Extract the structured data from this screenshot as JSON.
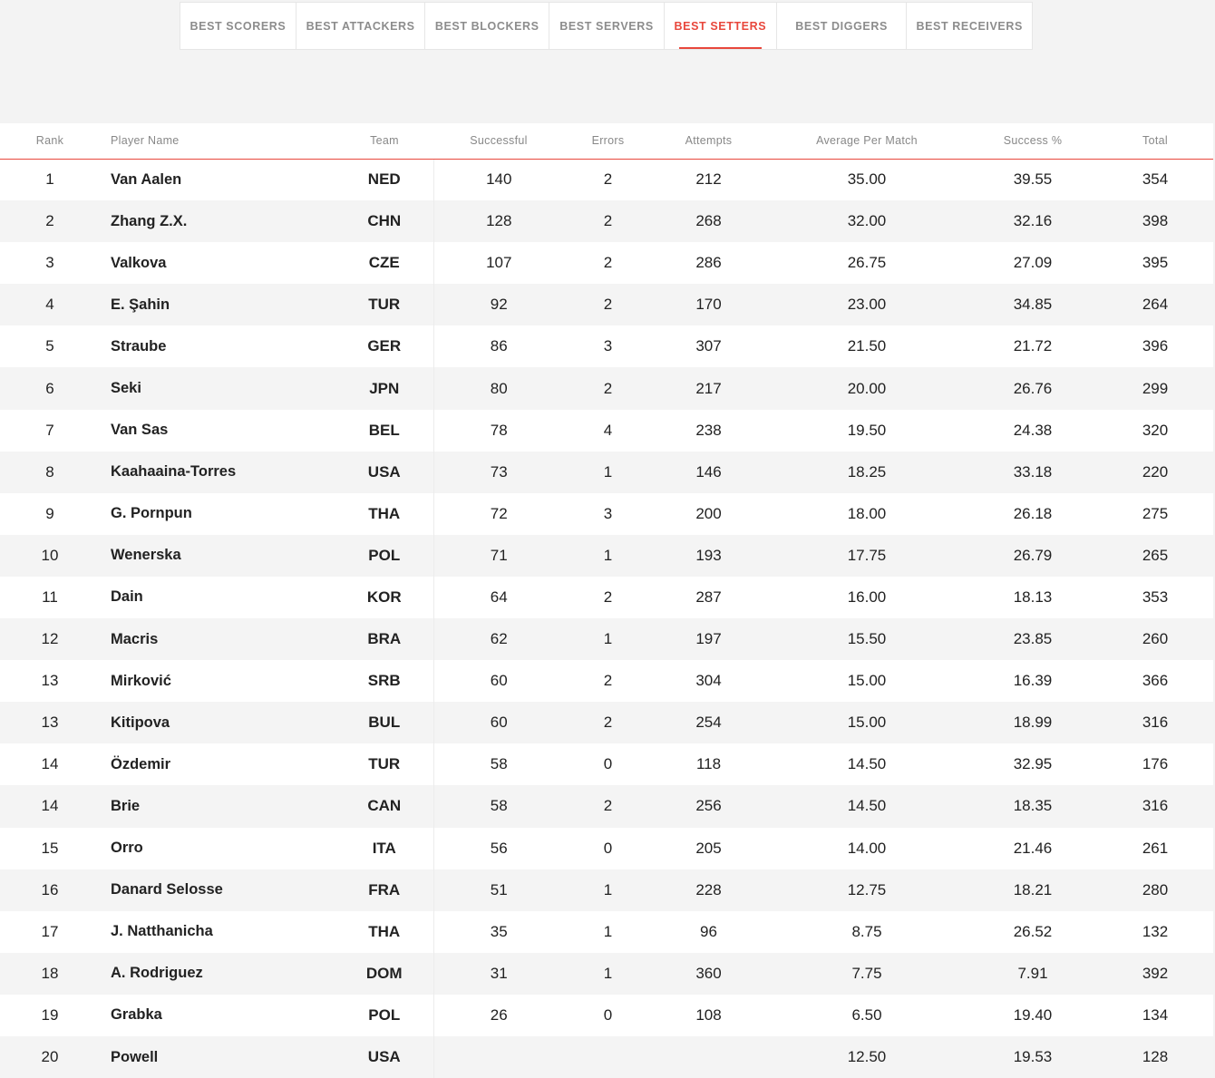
{
  "tabs": [
    {
      "label": "BEST SCORERS",
      "active": false
    },
    {
      "label": "BEST ATTACKERS",
      "active": false
    },
    {
      "label": "BEST BLOCKERS",
      "active": false
    },
    {
      "label": "BEST SERVERS",
      "active": false
    },
    {
      "label": "BEST SETTERS",
      "active": true
    },
    {
      "label": "BEST DIGGERS",
      "active": false
    },
    {
      "label": "BEST RECEIVERS",
      "active": false
    }
  ],
  "accent_color": "#e8473c",
  "table": {
    "headers": {
      "rank": "Rank",
      "player": "Player Name",
      "team": "Team",
      "successful": "Successful",
      "errors": "Errors",
      "attempts": "Attempts",
      "average": "Average Per Match",
      "success_pct": "Success %",
      "total": "Total"
    },
    "rows": [
      {
        "rank": "1",
        "player": "Van Aalen",
        "team": "NED",
        "successful": "140",
        "errors": "2",
        "attempts": "212",
        "average": "35.00",
        "success_pct": "39.55",
        "total": "354"
      },
      {
        "rank": "2",
        "player": "Zhang Z.X.",
        "team": "CHN",
        "successful": "128",
        "errors": "2",
        "attempts": "268",
        "average": "32.00",
        "success_pct": "32.16",
        "total": "398"
      },
      {
        "rank": "3",
        "player": "Valkova",
        "team": "CZE",
        "successful": "107",
        "errors": "2",
        "attempts": "286",
        "average": "26.75",
        "success_pct": "27.09",
        "total": "395"
      },
      {
        "rank": "4",
        "player": "E. Şahin",
        "team": "TUR",
        "successful": "92",
        "errors": "2",
        "attempts": "170",
        "average": "23.00",
        "success_pct": "34.85",
        "total": "264"
      },
      {
        "rank": "5",
        "player": "Straube",
        "team": "GER",
        "successful": "86",
        "errors": "3",
        "attempts": "307",
        "average": "21.50",
        "success_pct": "21.72",
        "total": "396"
      },
      {
        "rank": "6",
        "player": "Seki",
        "team": "JPN",
        "successful": "80",
        "errors": "2",
        "attempts": "217",
        "average": "20.00",
        "success_pct": "26.76",
        "total": "299"
      },
      {
        "rank": "7",
        "player": "Van Sas",
        "team": "BEL",
        "successful": "78",
        "errors": "4",
        "attempts": "238",
        "average": "19.50",
        "success_pct": "24.38",
        "total": "320"
      },
      {
        "rank": "8",
        "player": "Kaahaaina-Torres",
        "team": "USA",
        "successful": "73",
        "errors": "1",
        "attempts": "146",
        "average": "18.25",
        "success_pct": "33.18",
        "total": "220"
      },
      {
        "rank": "9",
        "player": "G. Pornpun",
        "team": "THA",
        "successful": "72",
        "errors": "3",
        "attempts": "200",
        "average": "18.00",
        "success_pct": "26.18",
        "total": "275"
      },
      {
        "rank": "10",
        "player": "Wenerska",
        "team": "POL",
        "successful": "71",
        "errors": "1",
        "attempts": "193",
        "average": "17.75",
        "success_pct": "26.79",
        "total": "265"
      },
      {
        "rank": "11",
        "player": "Dain",
        "team": "KOR",
        "successful": "64",
        "errors": "2",
        "attempts": "287",
        "average": "16.00",
        "success_pct": "18.13",
        "total": "353"
      },
      {
        "rank": "12",
        "player": "Macris",
        "team": "BRA",
        "successful": "62",
        "errors": "1",
        "attempts": "197",
        "average": "15.50",
        "success_pct": "23.85",
        "total": "260"
      },
      {
        "rank": "13",
        "player": "Mirković",
        "team": "SRB",
        "successful": "60",
        "errors": "2",
        "attempts": "304",
        "average": "15.00",
        "success_pct": "16.39",
        "total": "366"
      },
      {
        "rank": "13",
        "player": "Kitipova",
        "team": "BUL",
        "successful": "60",
        "errors": "2",
        "attempts": "254",
        "average": "15.00",
        "success_pct": "18.99",
        "total": "316"
      },
      {
        "rank": "14",
        "player": "Özdemir",
        "team": "TUR",
        "successful": "58",
        "errors": "0",
        "attempts": "118",
        "average": "14.50",
        "success_pct": "32.95",
        "total": "176"
      },
      {
        "rank": "14",
        "player": "Brie",
        "team": "CAN",
        "successful": "58",
        "errors": "2",
        "attempts": "256",
        "average": "14.50",
        "success_pct": "18.35",
        "total": "316"
      },
      {
        "rank": "15",
        "player": "Orro",
        "team": "ITA",
        "successful": "56",
        "errors": "0",
        "attempts": "205",
        "average": "14.00",
        "success_pct": "21.46",
        "total": "261"
      },
      {
        "rank": "16",
        "player": "Danard Selosse",
        "team": "FRA",
        "successful": "51",
        "errors": "1",
        "attempts": "228",
        "average": "12.75",
        "success_pct": "18.21",
        "total": "280"
      },
      {
        "rank": "17",
        "player": "J. Natthanicha",
        "team": "THA",
        "successful": "35",
        "errors": "1",
        "attempts": "96",
        "average": "8.75",
        "success_pct": "26.52",
        "total": "132"
      },
      {
        "rank": "18",
        "player": "A. Rodriguez",
        "team": "DOM",
        "successful": "31",
        "errors": "1",
        "attempts": "360",
        "average": "7.75",
        "success_pct": "7.91",
        "total": "392"
      },
      {
        "rank": "19",
        "player": "Grabka",
        "team": "POL",
        "successful": "26",
        "errors": "0",
        "attempts": "108",
        "average": "6.50",
        "success_pct": "19.40",
        "total": "134"
      },
      {
        "rank": "20",
        "player": "Powell",
        "team": "USA",
        "successful": "",
        "errors": "",
        "attempts": "",
        "average": "12.50",
        "success_pct": "19.53",
        "total": "128"
      }
    ]
  }
}
